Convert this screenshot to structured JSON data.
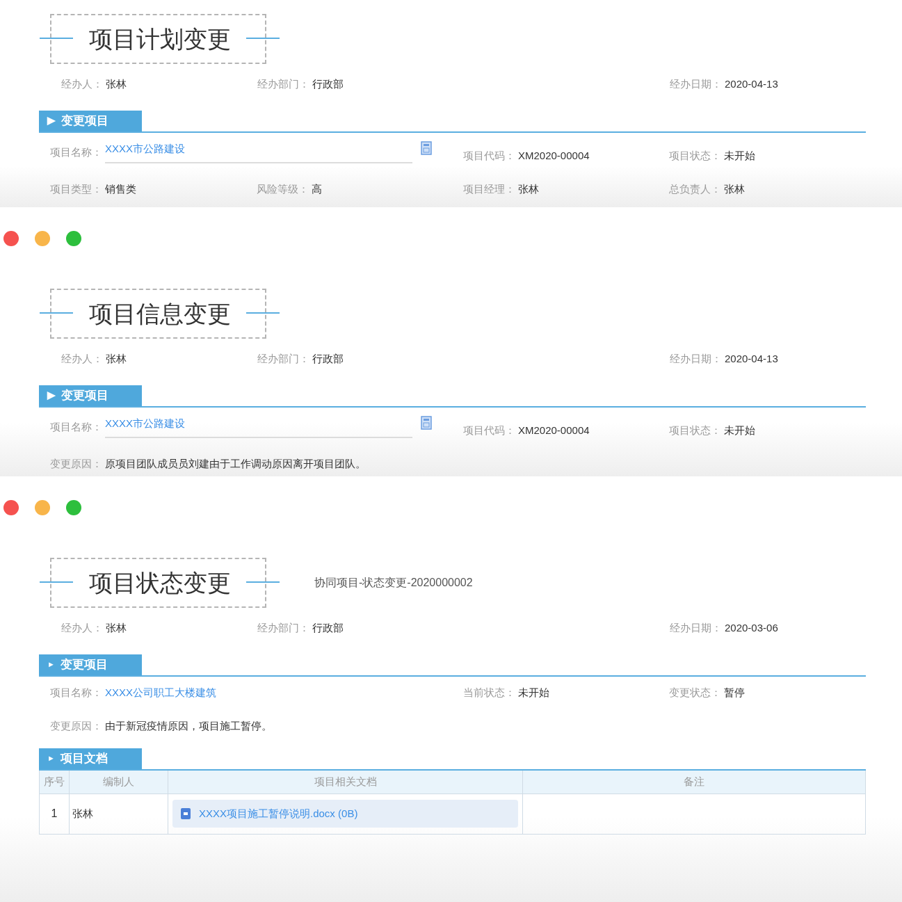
{
  "panels": [
    {
      "traffic_lights": false,
      "title": "项目计划变更",
      "meta": {
        "handler": {
          "label": "经办人：",
          "value": "张林"
        },
        "department": {
          "label": "经办部门：",
          "value": "行政部"
        },
        "date": {
          "label": "经办日期：",
          "value": "2020-04-13"
        }
      },
      "sections": [
        {
          "kind": "fields",
          "marker": "▶",
          "heading": "变更项目",
          "rows": [
            [
              {
                "kind": "link_field",
                "label": "项目名称：",
                "value": "XXXX市公路建设"
              },
              "",
              {
                "kind": "text",
                "label": "项目代码：",
                "value": "XM2020-00004"
              },
              {
                "kind": "text",
                "label": "项目状态：",
                "value": "未开始"
              }
            ],
            [
              {
                "kind": "text",
                "label": "项目类型：",
                "value": "销售类"
              },
              {
                "kind": "text",
                "label": "风险等级：",
                "value": "高"
              },
              {
                "kind": "text",
                "label": "项目经理：",
                "value": "张林"
              },
              {
                "kind": "text",
                "label": "总负责人：",
                "value": "张林"
              }
            ]
          ]
        }
      ]
    },
    {
      "traffic_lights": true,
      "title": "项目信息变更",
      "meta": {
        "handler": {
          "label": "经办人：",
          "value": "张林"
        },
        "department": {
          "label": "经办部门：",
          "value": "行政部"
        },
        "date": {
          "label": "经办日期：",
          "value": "2020-04-13"
        }
      },
      "sections": [
        {
          "kind": "fields",
          "marker": "▶",
          "heading": "变更项目",
          "rows": [
            [
              {
                "kind": "link_field",
                "label": "项目名称：",
                "value": "XXXX市公路建设"
              },
              "",
              {
                "kind": "text",
                "label": "项目代码：",
                "value": "XM2020-00004"
              },
              {
                "kind": "text",
                "label": "项目状态：",
                "value": "未开始"
              }
            ],
            [
              {
                "kind": "text",
                "label": "变更原因：",
                "value": "原项目团队成员员刘建由于工作调动原因离开项目团队。"
              }
            ]
          ]
        }
      ]
    },
    {
      "traffic_lights": true,
      "title": "项目状态变更",
      "doc_number": "协同项目-状态变更-2020000002",
      "meta": {
        "handler": {
          "label": "经办人：",
          "value": "张林"
        },
        "department": {
          "label": "经办部门：",
          "value": "行政部"
        },
        "date": {
          "label": "经办日期：",
          "value": "2020-03-06"
        }
      },
      "sections": [
        {
          "kind": "fields",
          "marker": "►",
          "heading": "变更项目",
          "rows": [
            [
              {
                "kind": "link",
                "label": "项目名称：",
                "value": "XXXX公司职工大楼建筑"
              },
              "",
              {
                "kind": "text",
                "label": "当前状态：",
                "value": "未开始"
              },
              {
                "kind": "text",
                "label": "变更状态：",
                "value": "暂停"
              }
            ],
            [
              {
                "kind": "text",
                "label": "变更原因：",
                "value": "由于新冠疫情原因，项目施工暂停。"
              }
            ]
          ]
        },
        {
          "kind": "table",
          "marker": "►",
          "heading": "项目文档",
          "columns": [
            "序号",
            "编制人",
            "项目相关文档",
            "备注"
          ],
          "rows": [
            {
              "index": "1",
              "author": "张林",
              "document": "XXXX项目施工暂停说明.docx (0B)"
            }
          ]
        }
      ]
    }
  ]
}
